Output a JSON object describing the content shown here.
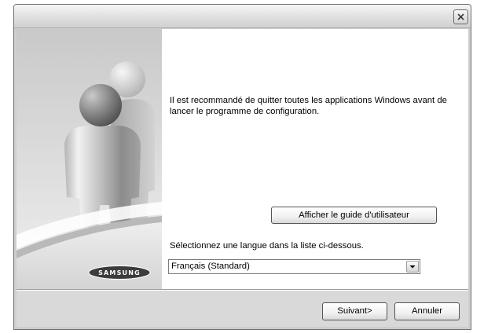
{
  "window": {
    "close_icon": "close-icon"
  },
  "sidebar": {
    "logo_text": "SAMSUNG"
  },
  "main": {
    "message": "Il est recommandé de quitter toutes les applications Windows avant de lancer le programme de configuration.",
    "guide_button_label": "Afficher le guide d'utilisateur",
    "language_label": "Sélectionnez une langue dans la liste ci-dessous.",
    "language_select": {
      "selected": "Français (Standard)",
      "dropdown_icon": "chevron-down-icon"
    }
  },
  "footer": {
    "next_label": "Suivant>",
    "cancel_label": "Annuler"
  },
  "colors": {
    "frame": "#cecece",
    "title_top": "#f6f6f6",
    "title_bottom": "#d0d0d0",
    "band": "#d9d9d9",
    "content": "#ffffff",
    "text": "#000000"
  }
}
